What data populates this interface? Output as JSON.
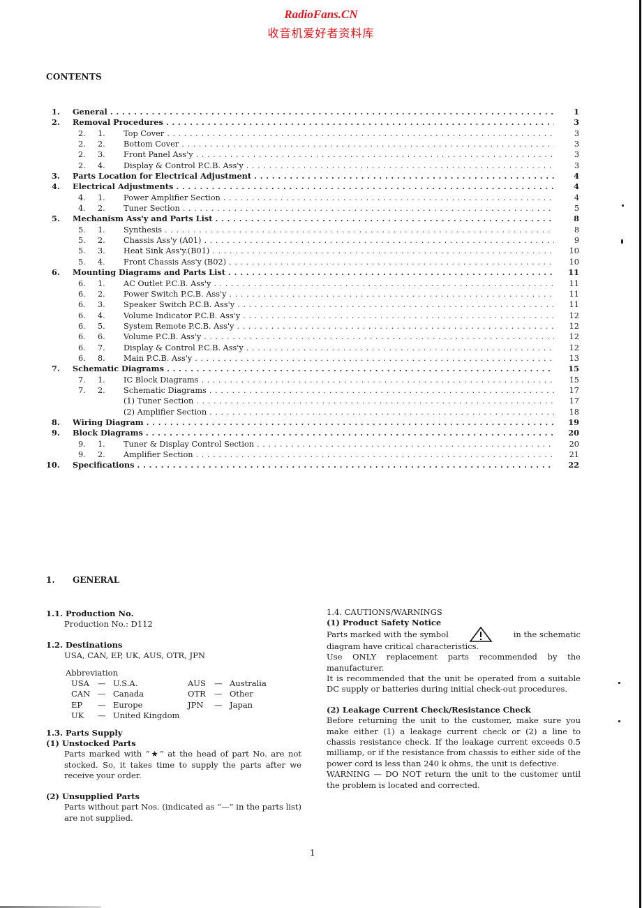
{
  "watermark": {
    "site": "RadioFans.CN",
    "subtitle": "收音机爱好者资料库",
    "color": "#e8141c"
  },
  "contents": {
    "title": "CONTENTS",
    "entries": [
      {
        "level": 1,
        "num": "1.",
        "title": "General",
        "page": "1"
      },
      {
        "level": 1,
        "num": "2.",
        "title": "Removal Procedures",
        "page": "3"
      },
      {
        "level": 2,
        "num_a": "2.",
        "num_b": "1.",
        "title": "Top Cover",
        "page": "3"
      },
      {
        "level": 2,
        "num_a": "2.",
        "num_b": "2.",
        "title": "Bottom Cover",
        "page": "3"
      },
      {
        "level": 2,
        "num_a": "2.",
        "num_b": "3.",
        "title": "Front Panel Ass'y",
        "page": "3"
      },
      {
        "level": 2,
        "num_a": "2.",
        "num_b": "4.",
        "title": "Display & Control P.C.B. Ass'y",
        "page": "3"
      },
      {
        "level": 1,
        "num": "3.",
        "title": "Parts Location for Electrical Adjustment",
        "page": "4"
      },
      {
        "level": 1,
        "num": "4.",
        "title": "Electrical Adjustments",
        "page": "4"
      },
      {
        "level": 2,
        "num_a": "4.",
        "num_b": "1.",
        "title": "Power Amplifier Section",
        "page": "4"
      },
      {
        "level": 2,
        "num_a": "4.",
        "num_b": "2.",
        "title": "Tuner Section",
        "page": "5"
      },
      {
        "level": 1,
        "num": "5.",
        "title": "Mechanism Ass'y and Parts List",
        "page": "8"
      },
      {
        "level": 2,
        "num_a": "5.",
        "num_b": "1.",
        "title": "Synthesis",
        "page": "8"
      },
      {
        "level": 2,
        "num_a": "5.",
        "num_b": "2.",
        "title": "Chassis Ass'y (A01)",
        "page": "9"
      },
      {
        "level": 2,
        "num_a": "5.",
        "num_b": "3.",
        "title": "Heat Sink Ass'y.(B01)",
        "page": "10"
      },
      {
        "level": 2,
        "num_a": "5.",
        "num_b": "4.",
        "title": "Front Chassis Ass'y (B02)",
        "page": "10"
      },
      {
        "level": 1,
        "num": "6.",
        "title": "Mounting Diagrams and Parts List",
        "page": "11"
      },
      {
        "level": 2,
        "num_a": "6.",
        "num_b": "1.",
        "title": "AC Outlet P.C.B. Ass'y",
        "page": "11"
      },
      {
        "level": 2,
        "num_a": "6.",
        "num_b": "2.",
        "title": "Power Switch P.C.B. Ass'y",
        "page": "11"
      },
      {
        "level": 2,
        "num_a": "6.",
        "num_b": "3.",
        "title": "Speaker Switch P.C.B. Ass'y",
        "page": "11"
      },
      {
        "level": 2,
        "num_a": "6.",
        "num_b": "4.",
        "title": "Volume Indicator P.C.B. Ass'y",
        "page": "12"
      },
      {
        "level": 2,
        "num_a": "6.",
        "num_b": "5.",
        "title": "System Remote P.C.B. Ass'y",
        "page": "12"
      },
      {
        "level": 2,
        "num_a": "6.",
        "num_b": "6.",
        "title": "Volume P.C.B. Ass'y",
        "page": "12"
      },
      {
        "level": 2,
        "num_a": "6.",
        "num_b": "7.",
        "title": "Display & Control P.C.B. Ass'y",
        "page": "12"
      },
      {
        "level": 2,
        "num_a": "6.",
        "num_b": "8.",
        "title": "Main P.C.B. Ass'y",
        "page": "13"
      },
      {
        "level": 1,
        "num": "7.",
        "title": "Schematic Diagrams",
        "page": "15"
      },
      {
        "level": 2,
        "num_a": "7.",
        "num_b": "1.",
        "title": "IC Block Diagrams",
        "page": "15"
      },
      {
        "level": 2,
        "num_a": "7.",
        "num_b": "2.",
        "title": "Schematic Diagrams",
        "page": "17"
      },
      {
        "level": 3,
        "title": "(1)  Tuner Section",
        "page": "17"
      },
      {
        "level": 3,
        "title": "(2)  Amplifier Section",
        "page": "18"
      },
      {
        "level": 1,
        "num": "8.",
        "title": "Wiring Diagram",
        "page": "19"
      },
      {
        "level": 1,
        "num": "9.",
        "title": "Block Diagrams",
        "page": "20"
      },
      {
        "level": 2,
        "num_a": "9.",
        "num_b": "1.",
        "title": "Tuner & Display Control Section",
        "page": "20"
      },
      {
        "level": 2,
        "num_a": "9.",
        "num_b": "2.",
        "title": "Amplifier Section",
        "page": "21"
      },
      {
        "level": 1,
        "num": "10.",
        "title": "Specifications",
        "page": "22"
      }
    ]
  },
  "general": {
    "num": "1.",
    "title": "GENERAL",
    "production": {
      "heading": "1.1.  Production No.",
      "value": "Production No.: D112"
    },
    "destinations": {
      "heading": "1.2.  Destinations",
      "value": "USA, CAN, EP, UK, AUS, OTR, JPN",
      "abbreviation_label": "Abbreviation",
      "abbreviations_left": [
        {
          "code": "USA",
          "name": "U.S.A."
        },
        {
          "code": "CAN",
          "name": "Canada"
        },
        {
          "code": "EP",
          "name": "Europe"
        },
        {
          "code": "UK",
          "name": "United Kingdom"
        }
      ],
      "abbreviations_right": [
        {
          "code": "AUS",
          "name": "Australia"
        },
        {
          "code": "OTR",
          "name": "Other"
        },
        {
          "code": "JPN",
          "name": "Japan"
        }
      ],
      "dash": "—"
    },
    "parts_supply": {
      "heading": "1.3.  Parts Supply",
      "unstocked_heading": "(1)  Unstocked Parts",
      "unstocked_text": "Parts marked with “★” at the head of part No. are not stocked. So, it takes time to supply the parts after we receive your order.",
      "unsupplied_heading": "(2)  Unsupplied Parts",
      "unsupplied_text": "Parts without part Nos. (indicated as “—” in the parts list) are not supplied."
    },
    "cautions": {
      "heading": "1.4.  CAUTIONS/WARNINGS",
      "safety_heading": "(1)  Product Safety Notice",
      "safety_text_before": "Parts marked with the symbol",
      "safety_symbol": "warning-triangle",
      "safety_text_after": "in the schematic",
      "safety_text_cont": "diagram have critical characteristics.",
      "replacement_text": "Use ONLY replacement parts recommended by the manufacturer.",
      "operation_text": "It is recommended that the unit be operated from a suitable DC supply or batteries during initial check-out procedures.",
      "leakage_heading": "(2)  Leakage Current Check/Resistance Check",
      "leakage_text": "Before returning the unit to the customer, make sure you make either (1) a leakage current check or (2) a line to chassis resistance check. If the leakage current exceeds 0.5 milliamp, or if the resistance from chassis to either side of the power cord is less than 240 k ohms, the unit is defective.",
      "warning_text": "WARNING — DO NOT return the unit to the customer until the problem is located and corrected."
    }
  },
  "page_number": "1"
}
